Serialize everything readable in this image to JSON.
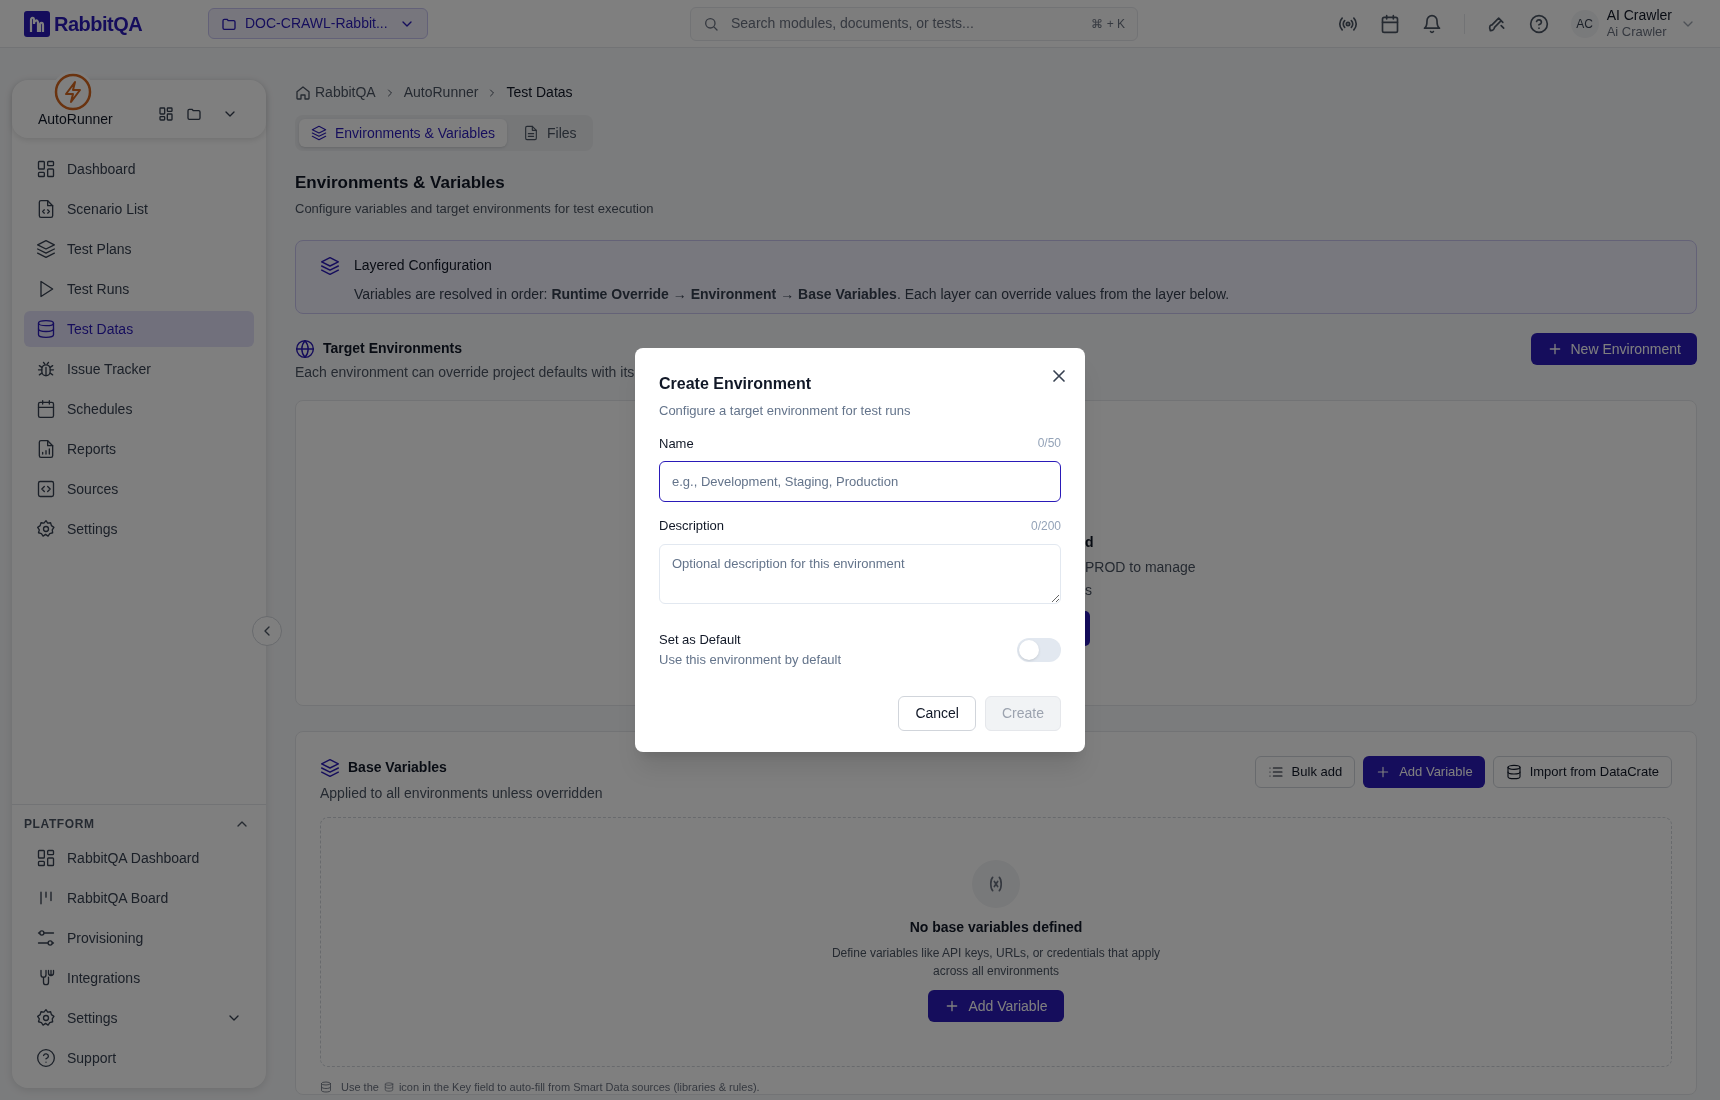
{
  "topbar": {
    "logo": "RabbitQA",
    "project": "DOC-CRAWL-Rabbit...",
    "search": {
      "placeholder": "Search modules, documents, or tests...",
      "shortcut": "⌘ + K"
    },
    "user": {
      "initials": "AC",
      "name": "AI Crawler",
      "role": "Ai Crawler"
    }
  },
  "sidebar": {
    "module": "AutoRunner",
    "items": [
      {
        "label": "Dashboard",
        "selected": false
      },
      {
        "label": "Scenario List",
        "selected": false
      },
      {
        "label": "Test Plans",
        "selected": false
      },
      {
        "label": "Test Runs",
        "selected": false
      },
      {
        "label": "Test Datas",
        "selected": true
      },
      {
        "label": "Issue Tracker",
        "selected": false
      },
      {
        "label": "Schedules",
        "selected": false
      },
      {
        "label": "Reports",
        "selected": false
      },
      {
        "label": "Sources",
        "selected": false
      },
      {
        "label": "Settings",
        "selected": false
      }
    ],
    "platform": {
      "title": "PLATFORM",
      "expanded": true,
      "items": [
        {
          "label": "RabbitQA Dashboard",
          "kind": "link"
        },
        {
          "label": "RabbitQA Board",
          "kind": "link"
        },
        {
          "label": "Provisioning",
          "kind": "link"
        },
        {
          "label": "Integrations",
          "kind": "link"
        },
        {
          "label": "Settings",
          "kind": "group",
          "expanded": false
        },
        {
          "label": "Support",
          "kind": "link"
        }
      ]
    }
  },
  "breadcrumb": [
    "RabbitQA",
    "AutoRunner",
    "Test Datas"
  ],
  "tabs": [
    {
      "label": "Environments & Variables",
      "selected": true
    },
    {
      "label": "Files",
      "selected": false
    }
  ],
  "heading": "Environments & Variables",
  "subtitle": "Configure variables and target environments for test execution",
  "info": {
    "title": "Layered Configuration",
    "text": "Variables are resolved in order: **Runtime Override** → **Environment** → **Base Variables**. Each layer can override values from the layer below."
  },
  "target_environments": {
    "title": "Target Environments",
    "subtitle": "Each environment can override project defaults with its",
    "button": "New Environment",
    "empty_title": "d",
    "empty_lines": [
      "PROD to manage",
      "s"
    ]
  },
  "base_variables": {
    "title": "Base Variables",
    "subtitle": "Applied to all environments unless overridden",
    "buttons": [
      {
        "label": "Bulk add",
        "kind": "outline"
      },
      {
        "label": "Add Variable",
        "kind": "primary"
      },
      {
        "label": "Import from DataCrate",
        "kind": "outline"
      }
    ],
    "empty_title": "No base variables defined",
    "empty_text": "Define variables like API keys, URLs, or credentials that apply across all environments",
    "empty_button": "Add Variable",
    "footnote_before": "Use the",
    "footnote_after": "icon in the Key field to auto-fill from Smart Data sources (libraries & rules)."
  },
  "modal": {
    "title": "Create Environment",
    "subtitle": "Configure a target environment for test runs",
    "fields": [
      {
        "kind": "input",
        "label": "Name",
        "counter": "0/50",
        "placeholder": "e.g., Development, Staging, Production",
        "focused": true
      },
      {
        "kind": "textarea",
        "label": "Description",
        "counter": "0/200",
        "placeholder": "Optional description for this environment",
        "focused": false
      }
    ],
    "toggle": {
      "label": "Set as Default",
      "hint": "Use this environment by default",
      "on": false
    },
    "buttons": [
      {
        "label": "Cancel",
        "disabled": false
      },
      {
        "label": "Create",
        "disabled": true
      }
    ]
  }
}
